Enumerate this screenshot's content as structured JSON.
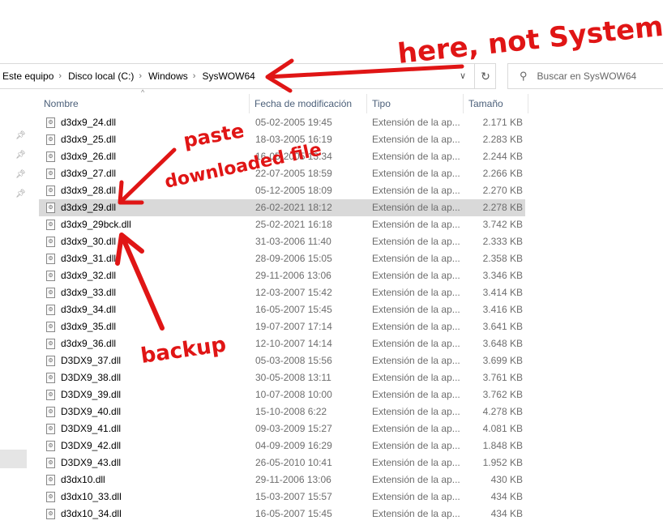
{
  "breadcrumb": [
    "Este equipo",
    "Disco local (C:)",
    "Windows",
    "SysWOW64"
  ],
  "search": {
    "placeholder": "Buscar en SysWOW64"
  },
  "columns": {
    "name": "Nombre",
    "date": "Fecha de modificación",
    "type": "Tipo",
    "size": "Tamaño"
  },
  "files": [
    {
      "name": "d3dx9_24.dll",
      "date": "05-02-2005 19:45",
      "type": "Extensión de la ap...",
      "size": "2.171 KB"
    },
    {
      "name": "d3dx9_25.dll",
      "date": "18-03-2005 16:19",
      "type": "Extensión de la ap...",
      "size": "2.283 KB"
    },
    {
      "name": "d3dx9_26.dll",
      "date": "16-05-2005 13:34",
      "type": "Extensión de la ap...",
      "size": "2.244 KB"
    },
    {
      "name": "d3dx9_27.dll",
      "date": "22-07-2005 18:59",
      "type": "Extensión de la ap...",
      "size": "2.266 KB"
    },
    {
      "name": "d3dx9_28.dll",
      "date": "05-12-2005 18:09",
      "type": "Extensión de la ap...",
      "size": "2.270 KB"
    },
    {
      "name": "d3dx9_29.dll",
      "date": "26-02-2021 18:12",
      "type": "Extensión de la ap...",
      "size": "2.278 KB",
      "selected": true
    },
    {
      "name": "d3dx9_29bck.dll",
      "date": "25-02-2021 16:18",
      "type": "Extensión de la ap...",
      "size": "3.742 KB"
    },
    {
      "name": "d3dx9_30.dll",
      "date": "31-03-2006 11:40",
      "type": "Extensión de la ap...",
      "size": "2.333 KB"
    },
    {
      "name": "d3dx9_31.dll",
      "date": "28-09-2006 15:05",
      "type": "Extensión de la ap...",
      "size": "2.358 KB"
    },
    {
      "name": "d3dx9_32.dll",
      "date": "29-11-2006 13:06",
      "type": "Extensión de la ap...",
      "size": "3.346 KB"
    },
    {
      "name": "d3dx9_33.dll",
      "date": "12-03-2007 15:42",
      "type": "Extensión de la ap...",
      "size": "3.414 KB"
    },
    {
      "name": "d3dx9_34.dll",
      "date": "16-05-2007 15:45",
      "type": "Extensión de la ap...",
      "size": "3.416 KB"
    },
    {
      "name": "d3dx9_35.dll",
      "date": "19-07-2007 17:14",
      "type": "Extensión de la ap...",
      "size": "3.641 KB"
    },
    {
      "name": "d3dx9_36.dll",
      "date": "12-10-2007 14:14",
      "type": "Extensión de la ap...",
      "size": "3.648 KB"
    },
    {
      "name": "D3DX9_37.dll",
      "date": "05-03-2008 15:56",
      "type": "Extensión de la ap...",
      "size": "3.699 KB"
    },
    {
      "name": "D3DX9_38.dll",
      "date": "30-05-2008 13:11",
      "type": "Extensión de la ap...",
      "size": "3.761 KB"
    },
    {
      "name": "D3DX9_39.dll",
      "date": "10-07-2008 10:00",
      "type": "Extensión de la ap...",
      "size": "3.762 KB"
    },
    {
      "name": "D3DX9_40.dll",
      "date": "15-10-2008 6:22",
      "type": "Extensión de la ap...",
      "size": "4.278 KB"
    },
    {
      "name": "D3DX9_41.dll",
      "date": "09-03-2009 15:27",
      "type": "Extensión de la ap...",
      "size": "4.081 KB"
    },
    {
      "name": "D3DX9_42.dll",
      "date": "04-09-2009 16:29",
      "type": "Extensión de la ap...",
      "size": "1.848 KB"
    },
    {
      "name": "D3DX9_43.dll",
      "date": "26-05-2010 10:41",
      "type": "Extensión de la ap...",
      "size": "1.952 KB"
    },
    {
      "name": "d3dx10.dll",
      "date": "29-11-2006 13:06",
      "type": "Extensión de la ap...",
      "size": "430 KB"
    },
    {
      "name": "d3dx10_33.dll",
      "date": "15-03-2007 15:57",
      "type": "Extensión de la ap...",
      "size": "434 KB"
    },
    {
      "name": "d3dx10_34.dll",
      "date": "16-05-2007 15:45",
      "type": "Extensión de la ap...",
      "size": "434 KB"
    }
  ],
  "annotations": {
    "top": "here, not System32",
    "paste": "paste",
    "downloaded": "downloaded file",
    "backup": "backup",
    "color": "#e01515"
  }
}
